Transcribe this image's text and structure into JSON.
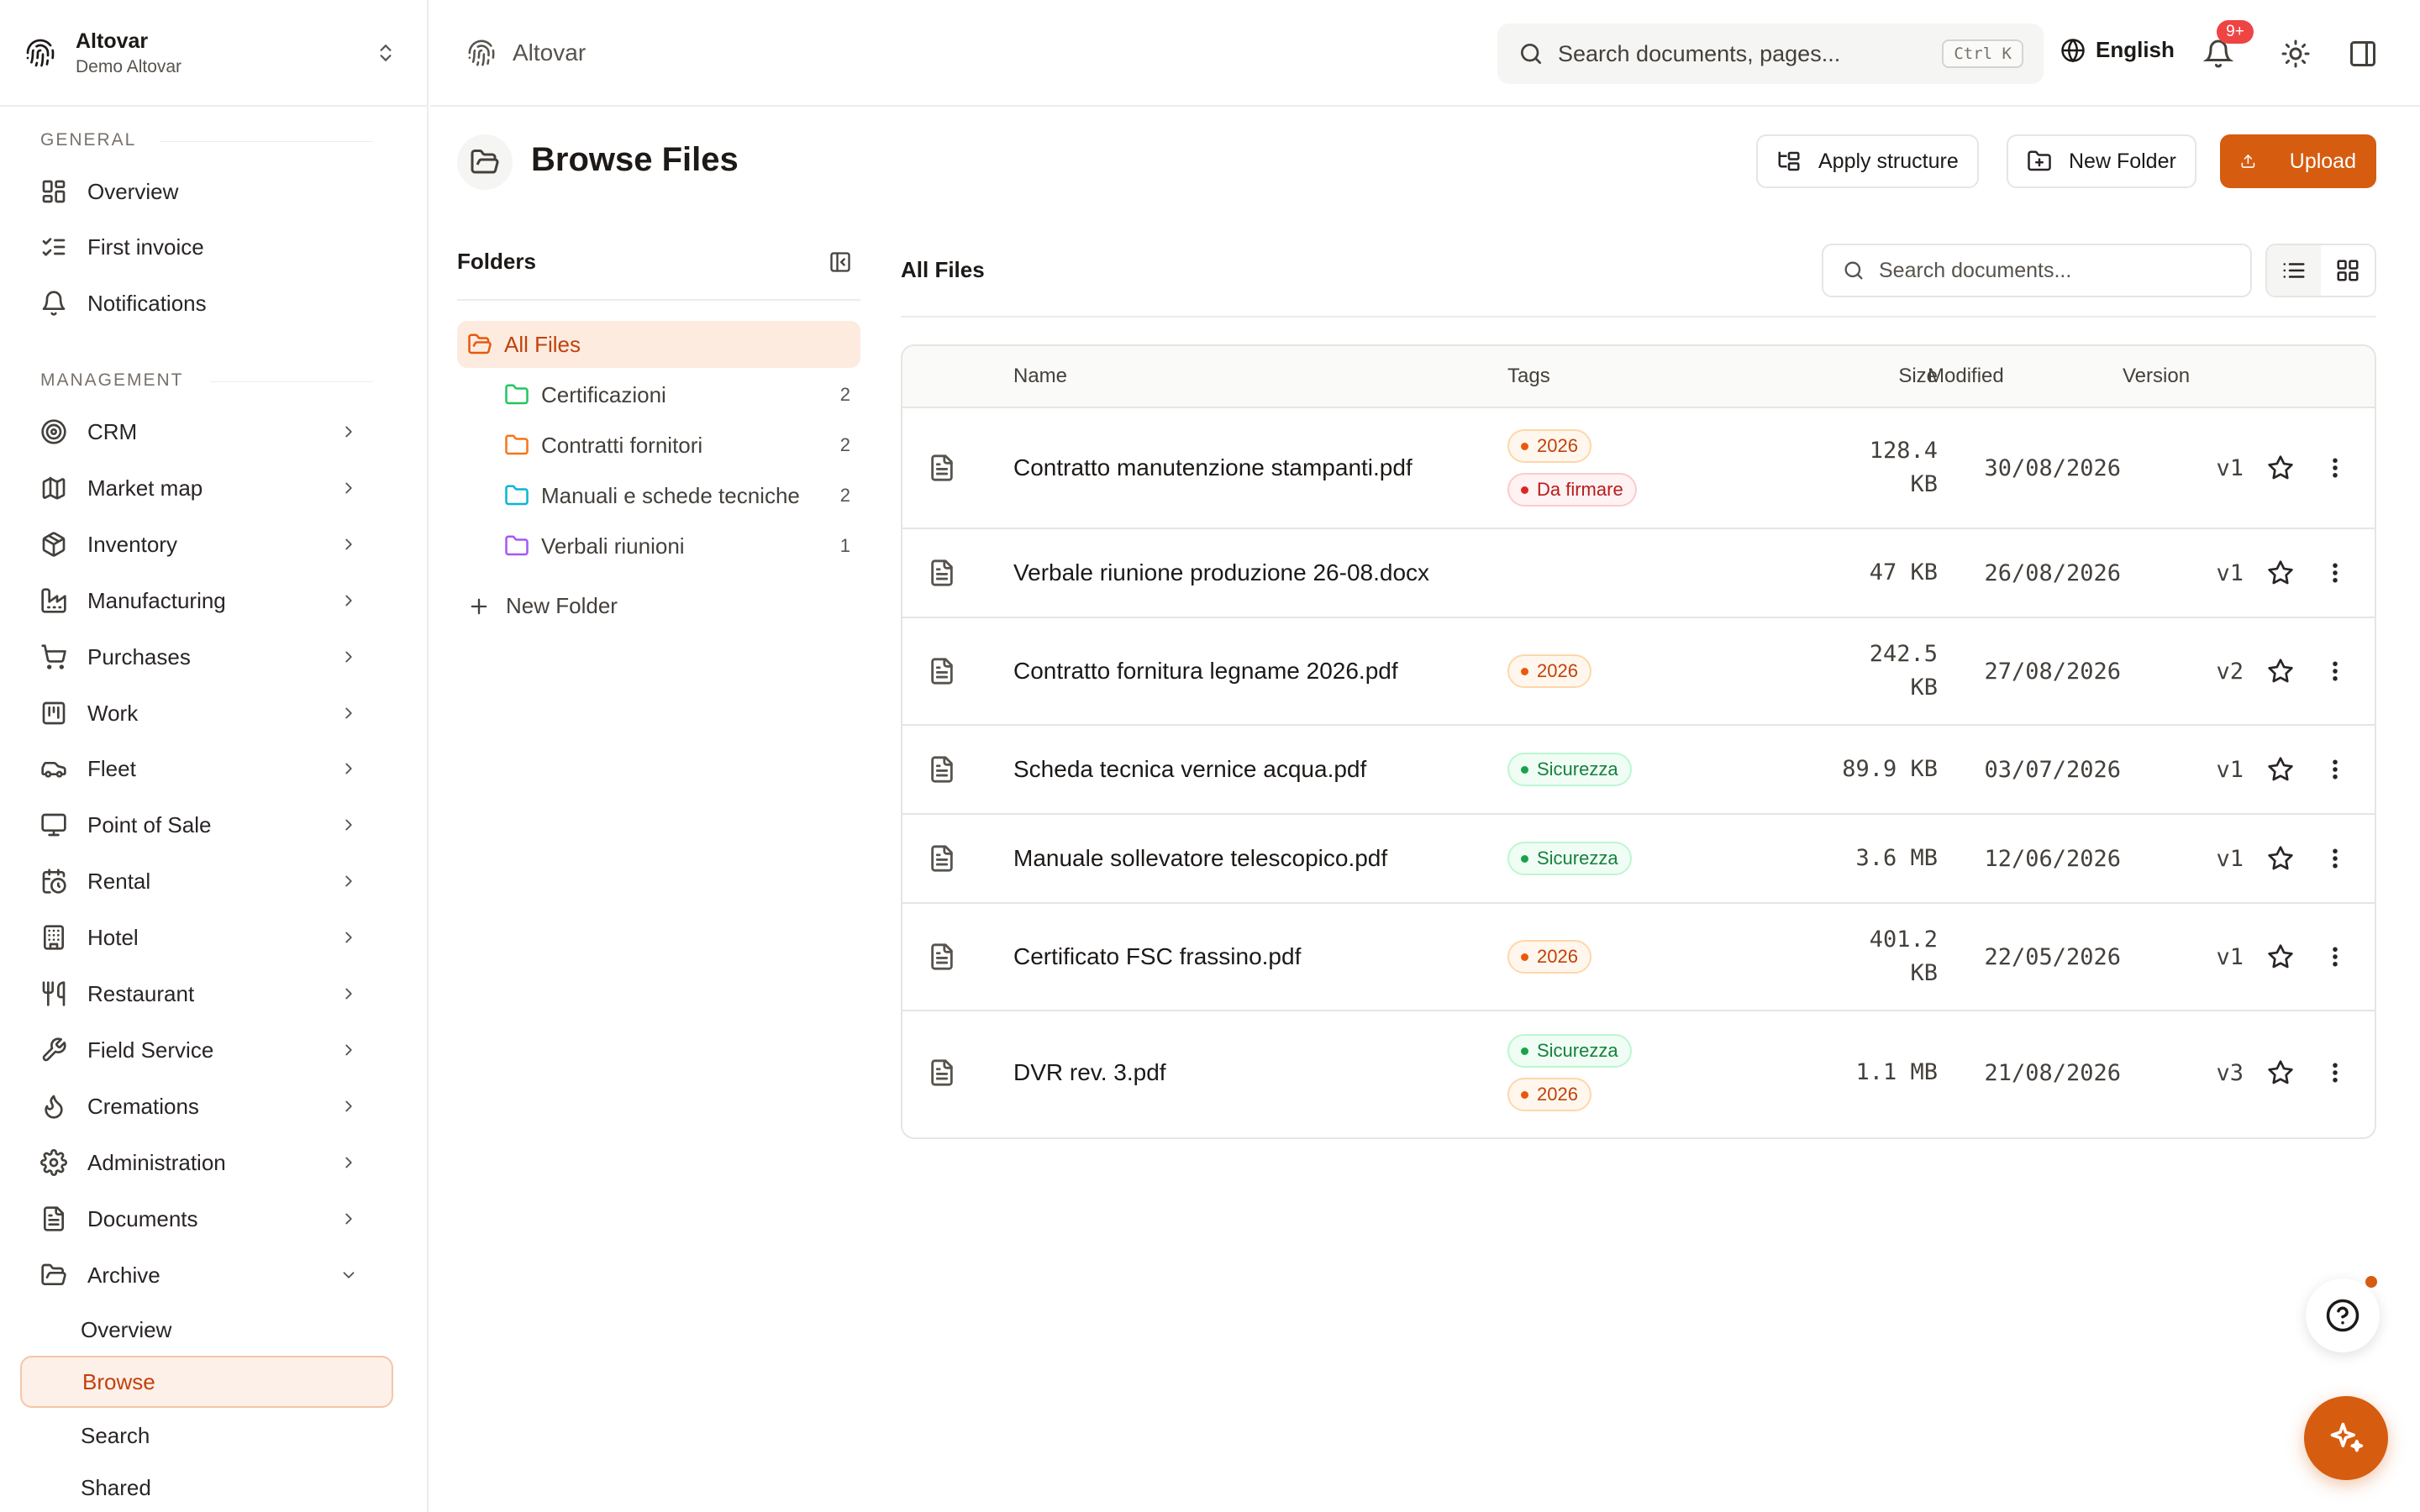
{
  "workspace": {
    "name": "Altovar",
    "subtitle": "Demo Altovar"
  },
  "sidebar": {
    "general_label": "GENERAL",
    "general_items": [
      {
        "label": "Overview",
        "icon": "layout-dashboard-icon"
      },
      {
        "label": "First invoice",
        "icon": "list-checks-icon"
      },
      {
        "label": "Notifications",
        "icon": "bell-icon"
      }
    ],
    "management_label": "MANAGEMENT",
    "management_items": [
      {
        "label": "CRM",
        "icon": "target-icon"
      },
      {
        "label": "Market map",
        "icon": "map-icon"
      },
      {
        "label": "Inventory",
        "icon": "package-icon"
      },
      {
        "label": "Manufacturing",
        "icon": "factory-icon"
      },
      {
        "label": "Purchases",
        "icon": "cart-icon"
      },
      {
        "label": "Work",
        "icon": "kanban-icon"
      },
      {
        "label": "Fleet",
        "icon": "car-icon"
      },
      {
        "label": "Point of Sale",
        "icon": "monitor-icon"
      },
      {
        "label": "Rental",
        "icon": "calendar-clock-icon"
      },
      {
        "label": "Hotel",
        "icon": "building-icon"
      },
      {
        "label": "Restaurant",
        "icon": "utensils-icon"
      },
      {
        "label": "Field Service",
        "icon": "wrench-icon"
      },
      {
        "label": "Cremations",
        "icon": "flame-icon"
      },
      {
        "label": "Administration",
        "icon": "gear-icon"
      },
      {
        "label": "Documents",
        "icon": "file-text-icon"
      },
      {
        "label": "Archive",
        "icon": "folder-open-icon"
      }
    ],
    "archive_sub": [
      "Overview",
      "Browse",
      "Search",
      "Shared"
    ]
  },
  "topbar": {
    "breadcrumb": "Altovar",
    "search_placeholder": "Search documents, pages...",
    "search_shortcut": "Ctrl K",
    "language": "English",
    "notification_count": "9+"
  },
  "page": {
    "title": "Browse Files",
    "apply_structure": "Apply structure",
    "new_folder": "New Folder",
    "upload": "Upload"
  },
  "folders": {
    "title": "Folders",
    "root": "All Files",
    "items": [
      {
        "name": "Certificazioni",
        "count": "2",
        "color": "#22c55e"
      },
      {
        "name": "Contratti fornitori",
        "count": "2",
        "color": "#f97316"
      },
      {
        "name": "Manuali e schede tecniche",
        "count": "2",
        "color": "#06b6d4"
      },
      {
        "name": "Verbali riunioni",
        "count": "1",
        "color": "#a855f7"
      }
    ],
    "new_folder": "New Folder"
  },
  "files": {
    "title": "All Files",
    "search_placeholder": "Search documents...",
    "columns": {
      "name": "Name",
      "tags": "Tags",
      "size": "Size",
      "modified": "Modified",
      "version": "Version"
    },
    "rows": [
      {
        "name": "Contratto manutenzione stampanti.pdf",
        "tags": [
          {
            "label": "2026",
            "color": "orange"
          },
          {
            "label": "Da firmare",
            "color": "red"
          }
        ],
        "size": [
          "128.4",
          "KB"
        ],
        "modified": "30/08/2026",
        "version": "v1"
      },
      {
        "name": "Verbale riunione produzione 26-08.docx",
        "tags": [],
        "size": [
          "47 KB"
        ],
        "modified": "26/08/2026",
        "version": "v1"
      },
      {
        "name": "Contratto fornitura legname 2026.pdf",
        "tags": [
          {
            "label": "2026",
            "color": "orange"
          }
        ],
        "size": [
          "242.5",
          "KB"
        ],
        "modified": "27/08/2026",
        "version": "v2"
      },
      {
        "name": "Scheda tecnica vernice acqua.pdf",
        "tags": [
          {
            "label": "Sicurezza",
            "color": "green"
          }
        ],
        "size": [
          "89.9 KB"
        ],
        "modified": "03/07/2026",
        "version": "v1"
      },
      {
        "name": "Manuale sollevatore telescopico.pdf",
        "tags": [
          {
            "label": "Sicurezza",
            "color": "green"
          }
        ],
        "size": [
          "3.6 MB"
        ],
        "modified": "12/06/2026",
        "version": "v1"
      },
      {
        "name": "Certificato FSC frassino.pdf",
        "tags": [
          {
            "label": "2026",
            "color": "orange"
          }
        ],
        "size": [
          "401.2",
          "KB"
        ],
        "modified": "22/05/2026",
        "version": "v1"
      },
      {
        "name": "DVR rev. 3.pdf",
        "tags": [
          {
            "label": "Sicurezza",
            "color": "green"
          },
          {
            "label": "2026",
            "color": "orange"
          }
        ],
        "size": [
          "1.1 MB"
        ],
        "modified": "21/08/2026",
        "version": "v3"
      }
    ]
  },
  "colors": {
    "accent": "#d65c10"
  }
}
